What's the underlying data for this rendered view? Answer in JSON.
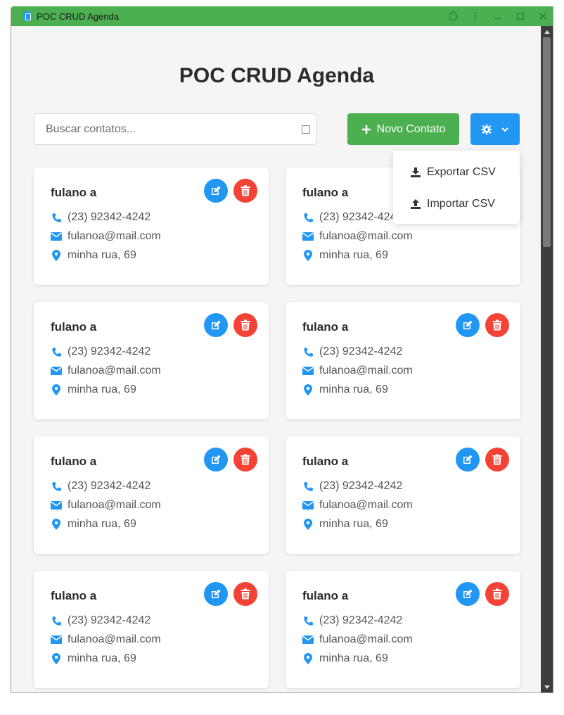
{
  "window": {
    "title": "POC CRUD Agenda"
  },
  "page": {
    "title": "POC CRUD Agenda"
  },
  "search": {
    "placeholder": "Buscar contatos...",
    "value": ""
  },
  "toolbar": {
    "new_contact_label": "Novo Contato"
  },
  "settings_menu": {
    "export_label": "Exportar CSV",
    "import_label": "Importar CSV"
  },
  "contacts": [
    {
      "name": "fulano a",
      "phone": "(23) 92342-4242",
      "email": "fulanoa@mail.com",
      "address": "minha rua, 69"
    },
    {
      "name": "fulano a",
      "phone": "(23) 92342-4242",
      "email": "fulanoa@mail.com",
      "address": "minha rua, 69"
    },
    {
      "name": "fulano a",
      "phone": "(23) 92342-4242",
      "email": "fulanoa@mail.com",
      "address": "minha rua, 69"
    },
    {
      "name": "fulano a",
      "phone": "(23) 92342-4242",
      "email": "fulanoa@mail.com",
      "address": "minha rua, 69"
    },
    {
      "name": "fulano a",
      "phone": "(23) 92342-4242",
      "email": "fulanoa@mail.com",
      "address": "minha rua, 69"
    },
    {
      "name": "fulano a",
      "phone": "(23) 92342-4242",
      "email": "fulanoa@mail.com",
      "address": "minha rua, 69"
    },
    {
      "name": "fulano a",
      "phone": "(23) 92342-4242",
      "email": "fulanoa@mail.com",
      "address": "minha rua, 69"
    },
    {
      "name": "fulano a",
      "phone": "(23) 92342-4242",
      "email": "fulanoa@mail.com",
      "address": "minha rua, 69"
    }
  ],
  "colors": {
    "primary": "#2196f3",
    "success": "#4caf50",
    "danger": "#f44336",
    "titlebar": "#4caf50"
  },
  "icons": [
    "phone-icon",
    "envelope-icon",
    "map-marker-icon",
    "edit-icon",
    "trash-icon",
    "plus-icon",
    "gear-icon",
    "chevron-down-icon",
    "download-icon",
    "upload-icon"
  ]
}
